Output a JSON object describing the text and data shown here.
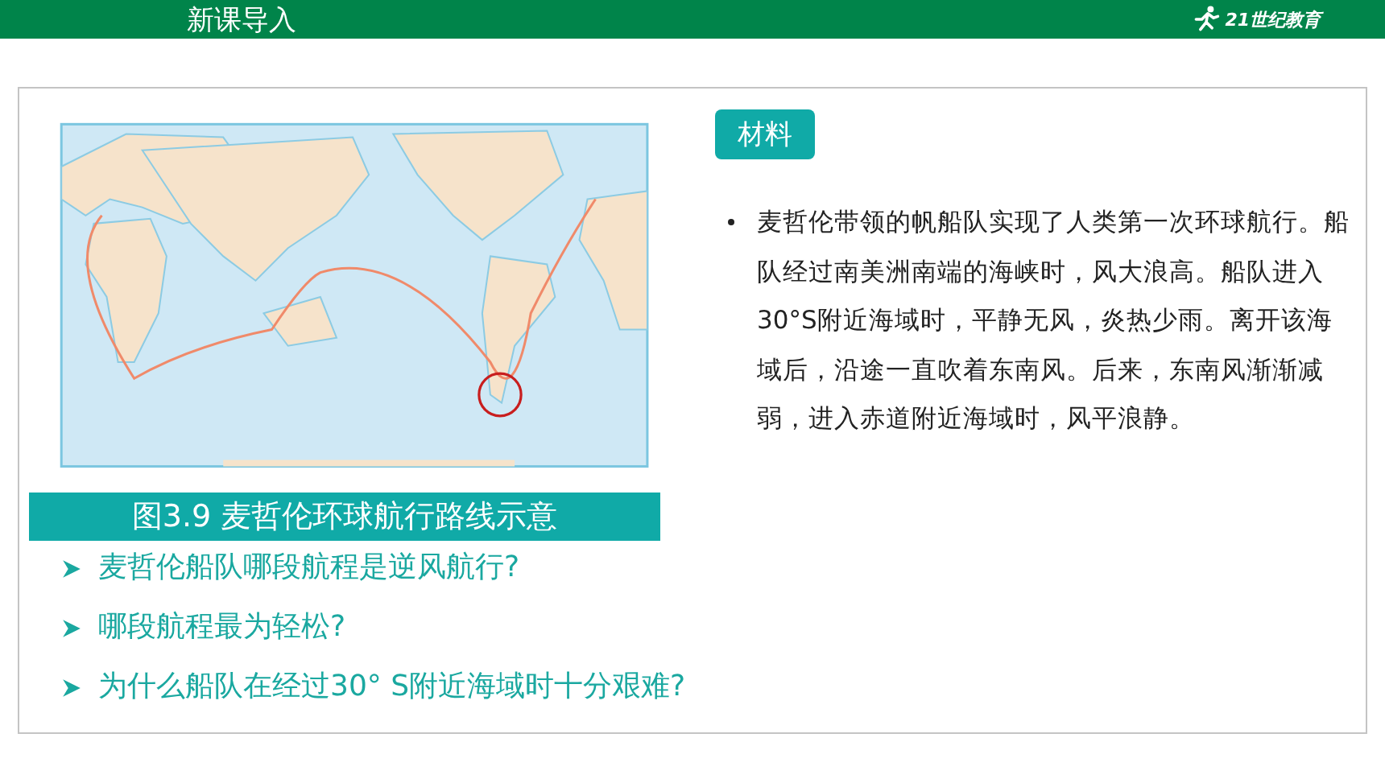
{
  "header": {
    "title": "新课导入",
    "logo_text": "21世纪教育"
  },
  "figure": {
    "caption": "图3.9 麦哲伦环球航行路线示意"
  },
  "material": {
    "badge": "材料",
    "paragraph": "麦哲伦带领的帆船队实现了人类第一次环球航行。船队经过南美洲南端的海峡时，风大浪高。船队进入30°S附近海域时，平静无风，炎热少雨。离开该海域后，沿途一直吹着东南风。后来，东南风渐渐减弱，进入赤道附近海域时，风平浪静。"
  },
  "questions": [
    "麦哲伦船队哪段航程是逆风航行?",
    "哪段航程最为轻松?",
    "为什么船队在经过30° S附近海域时十分艰难?"
  ]
}
